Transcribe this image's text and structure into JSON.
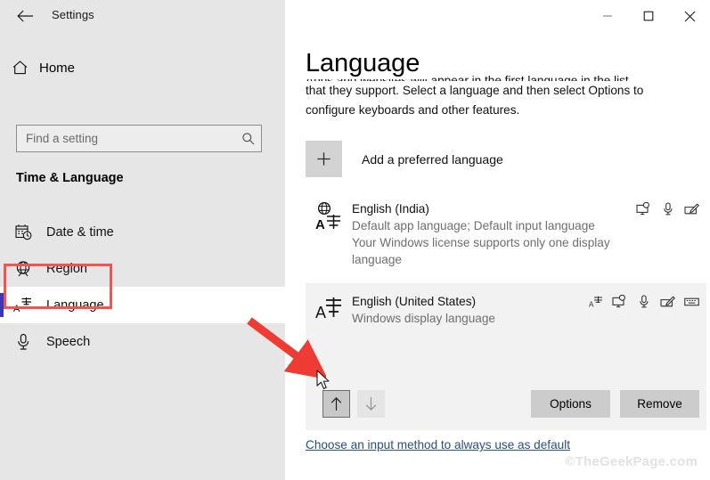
{
  "window": {
    "title": "Settings",
    "back_icon": "back-arrow-icon",
    "minimize_label": "minimize-icon",
    "maximize_label": "maximize-icon",
    "close_label": "close-icon"
  },
  "sidebar": {
    "home_label": "Home",
    "home_icon": "home-icon",
    "search": {
      "placeholder": "Find a setting",
      "value": "",
      "icon": "search-icon"
    },
    "section_title": "Time & Language",
    "items": [
      {
        "label": "Date & time",
        "icon": "calendar-clock-icon",
        "selected": false
      },
      {
        "label": "Region",
        "icon": "globe-icon",
        "selected": false
      },
      {
        "label": "Language",
        "icon": "language-icon",
        "selected": true
      },
      {
        "label": "Speech",
        "icon": "microphone-icon",
        "selected": false
      }
    ]
  },
  "main": {
    "page_title": "Language",
    "description_line1": "Apps and websites will appear in the first language in the list",
    "description_line2": "that they support. Select a language and then select Options to",
    "description_line3": "configure keyboards and other features.",
    "add_language": {
      "label": "Add a preferred language",
      "icon": "plus-icon"
    },
    "languages": [
      {
        "name": "English (India)",
        "sub_lines": [
          "Default app language; Default input language",
          "Your Windows license supports only one display",
          "language"
        ],
        "glyph": "language-glyph-icon",
        "selected": false,
        "feature_icons": [
          "display-icon",
          "microphone-icon",
          "handwriting-icon"
        ]
      },
      {
        "name": "English (United States)",
        "sub_lines": [
          "Windows display language"
        ],
        "glyph": "language-glyph-icon",
        "selected": true,
        "feature_icons": [
          "language-pack-icon",
          "display-icon",
          "microphone-icon",
          "handwriting-icon",
          "keyboard-icon"
        ]
      }
    ],
    "move_up": {
      "icon": "arrow-up-icon",
      "state": "hovered"
    },
    "move_down": {
      "icon": "arrow-down-icon",
      "state": "disabled"
    },
    "options_button": "Options",
    "remove_button": "Remove",
    "default_input_link": "Choose an input method to always use as default"
  },
  "watermark": "©TheGeekPage.com",
  "annotations": {
    "highlight_color": "#f2554f",
    "arrow_color": "#ee3b33",
    "accent_color": "#3a38b4"
  }
}
